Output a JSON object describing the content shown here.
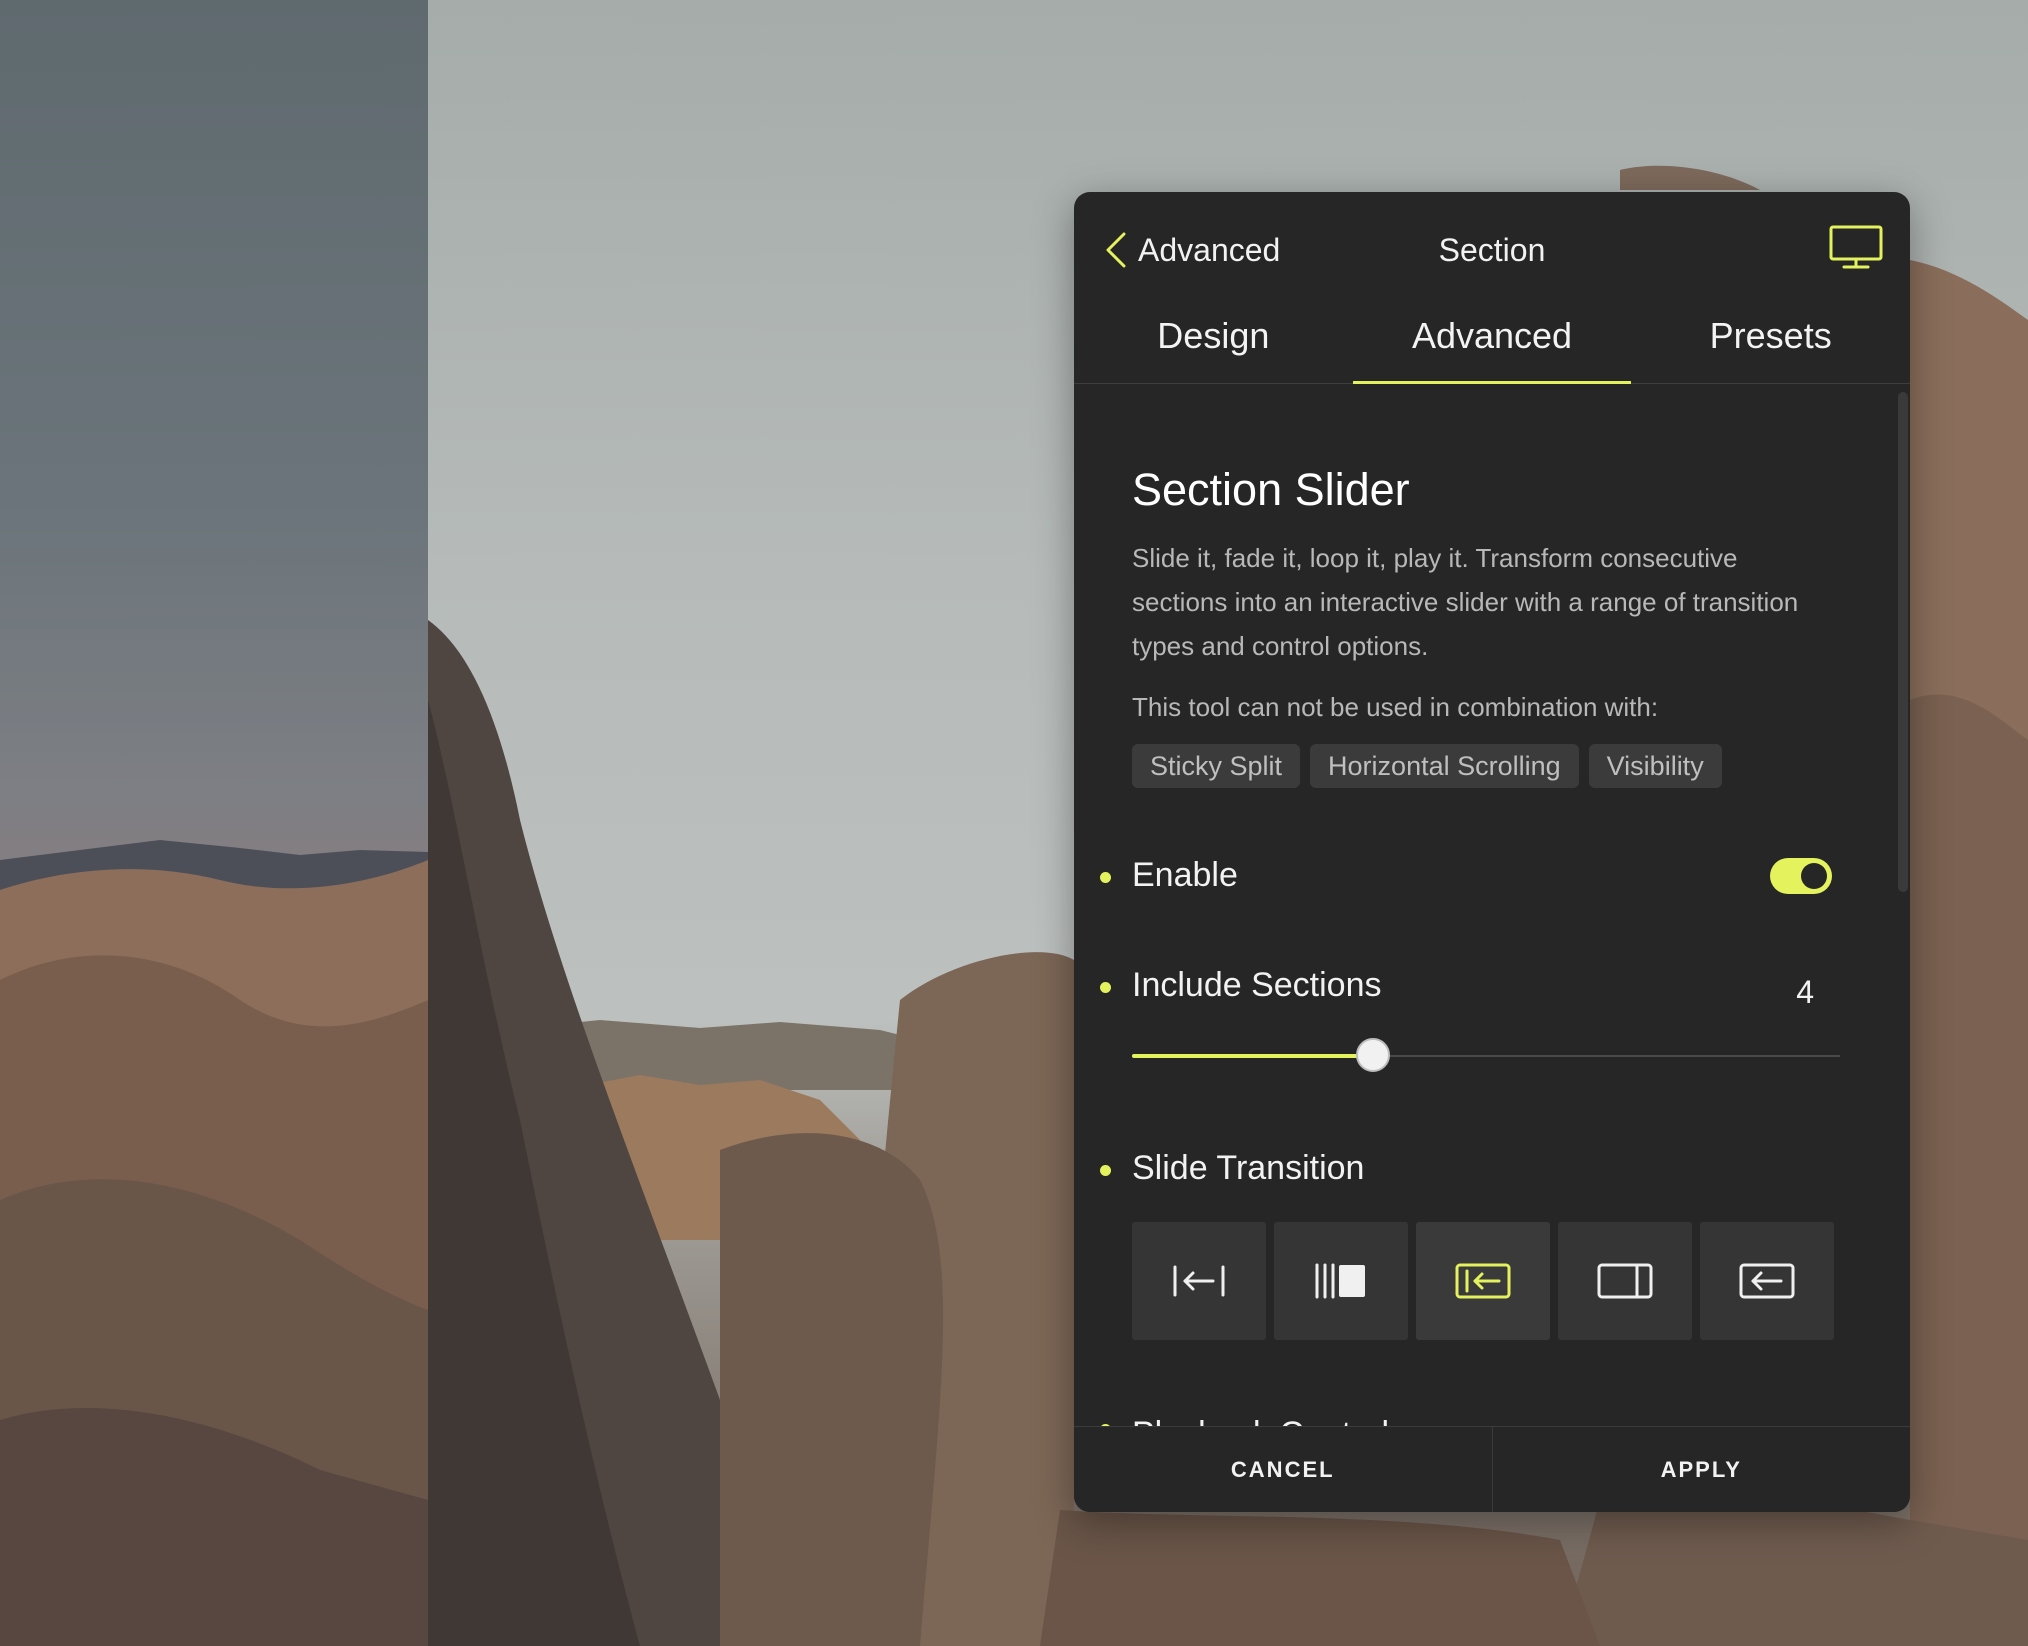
{
  "header": {
    "back_label": "Advanced",
    "title": "Section",
    "device_icon": "desktop-icon"
  },
  "tabs": [
    {
      "label": "Design",
      "active": false
    },
    {
      "label": "Advanced",
      "active": true
    },
    {
      "label": "Presets",
      "active": false
    }
  ],
  "section": {
    "heading": "Section Slider",
    "description": "Slide it, fade it, loop it, play it. Transform consecutive sections into an interactive slider with a range of transition types and control options.",
    "combo_note": "This tool can not be used in combination with:",
    "chips": [
      "Sticky Split",
      "Horizontal Scrolling",
      "Visibility"
    ]
  },
  "enable": {
    "label": "Enable",
    "on": true
  },
  "include_sections": {
    "label": "Include Sections",
    "value": "4",
    "slider_fraction": 0.34
  },
  "slide_transition": {
    "label": "Slide Transition",
    "options": [
      {
        "icon": "slide-arrow-icon",
        "selected": false
      },
      {
        "icon": "stack-bars-icon",
        "selected": false
      },
      {
        "icon": "push-in-icon",
        "selected": true
      },
      {
        "icon": "panel-right-icon",
        "selected": false
      },
      {
        "icon": "arrow-box-icon",
        "selected": false
      }
    ]
  },
  "next_section_label": "Playback Controls",
  "footer": {
    "cancel": "CANCEL",
    "apply": "APPLY"
  },
  "colors": {
    "accent": "#e4f35d",
    "panel": "#262626"
  }
}
